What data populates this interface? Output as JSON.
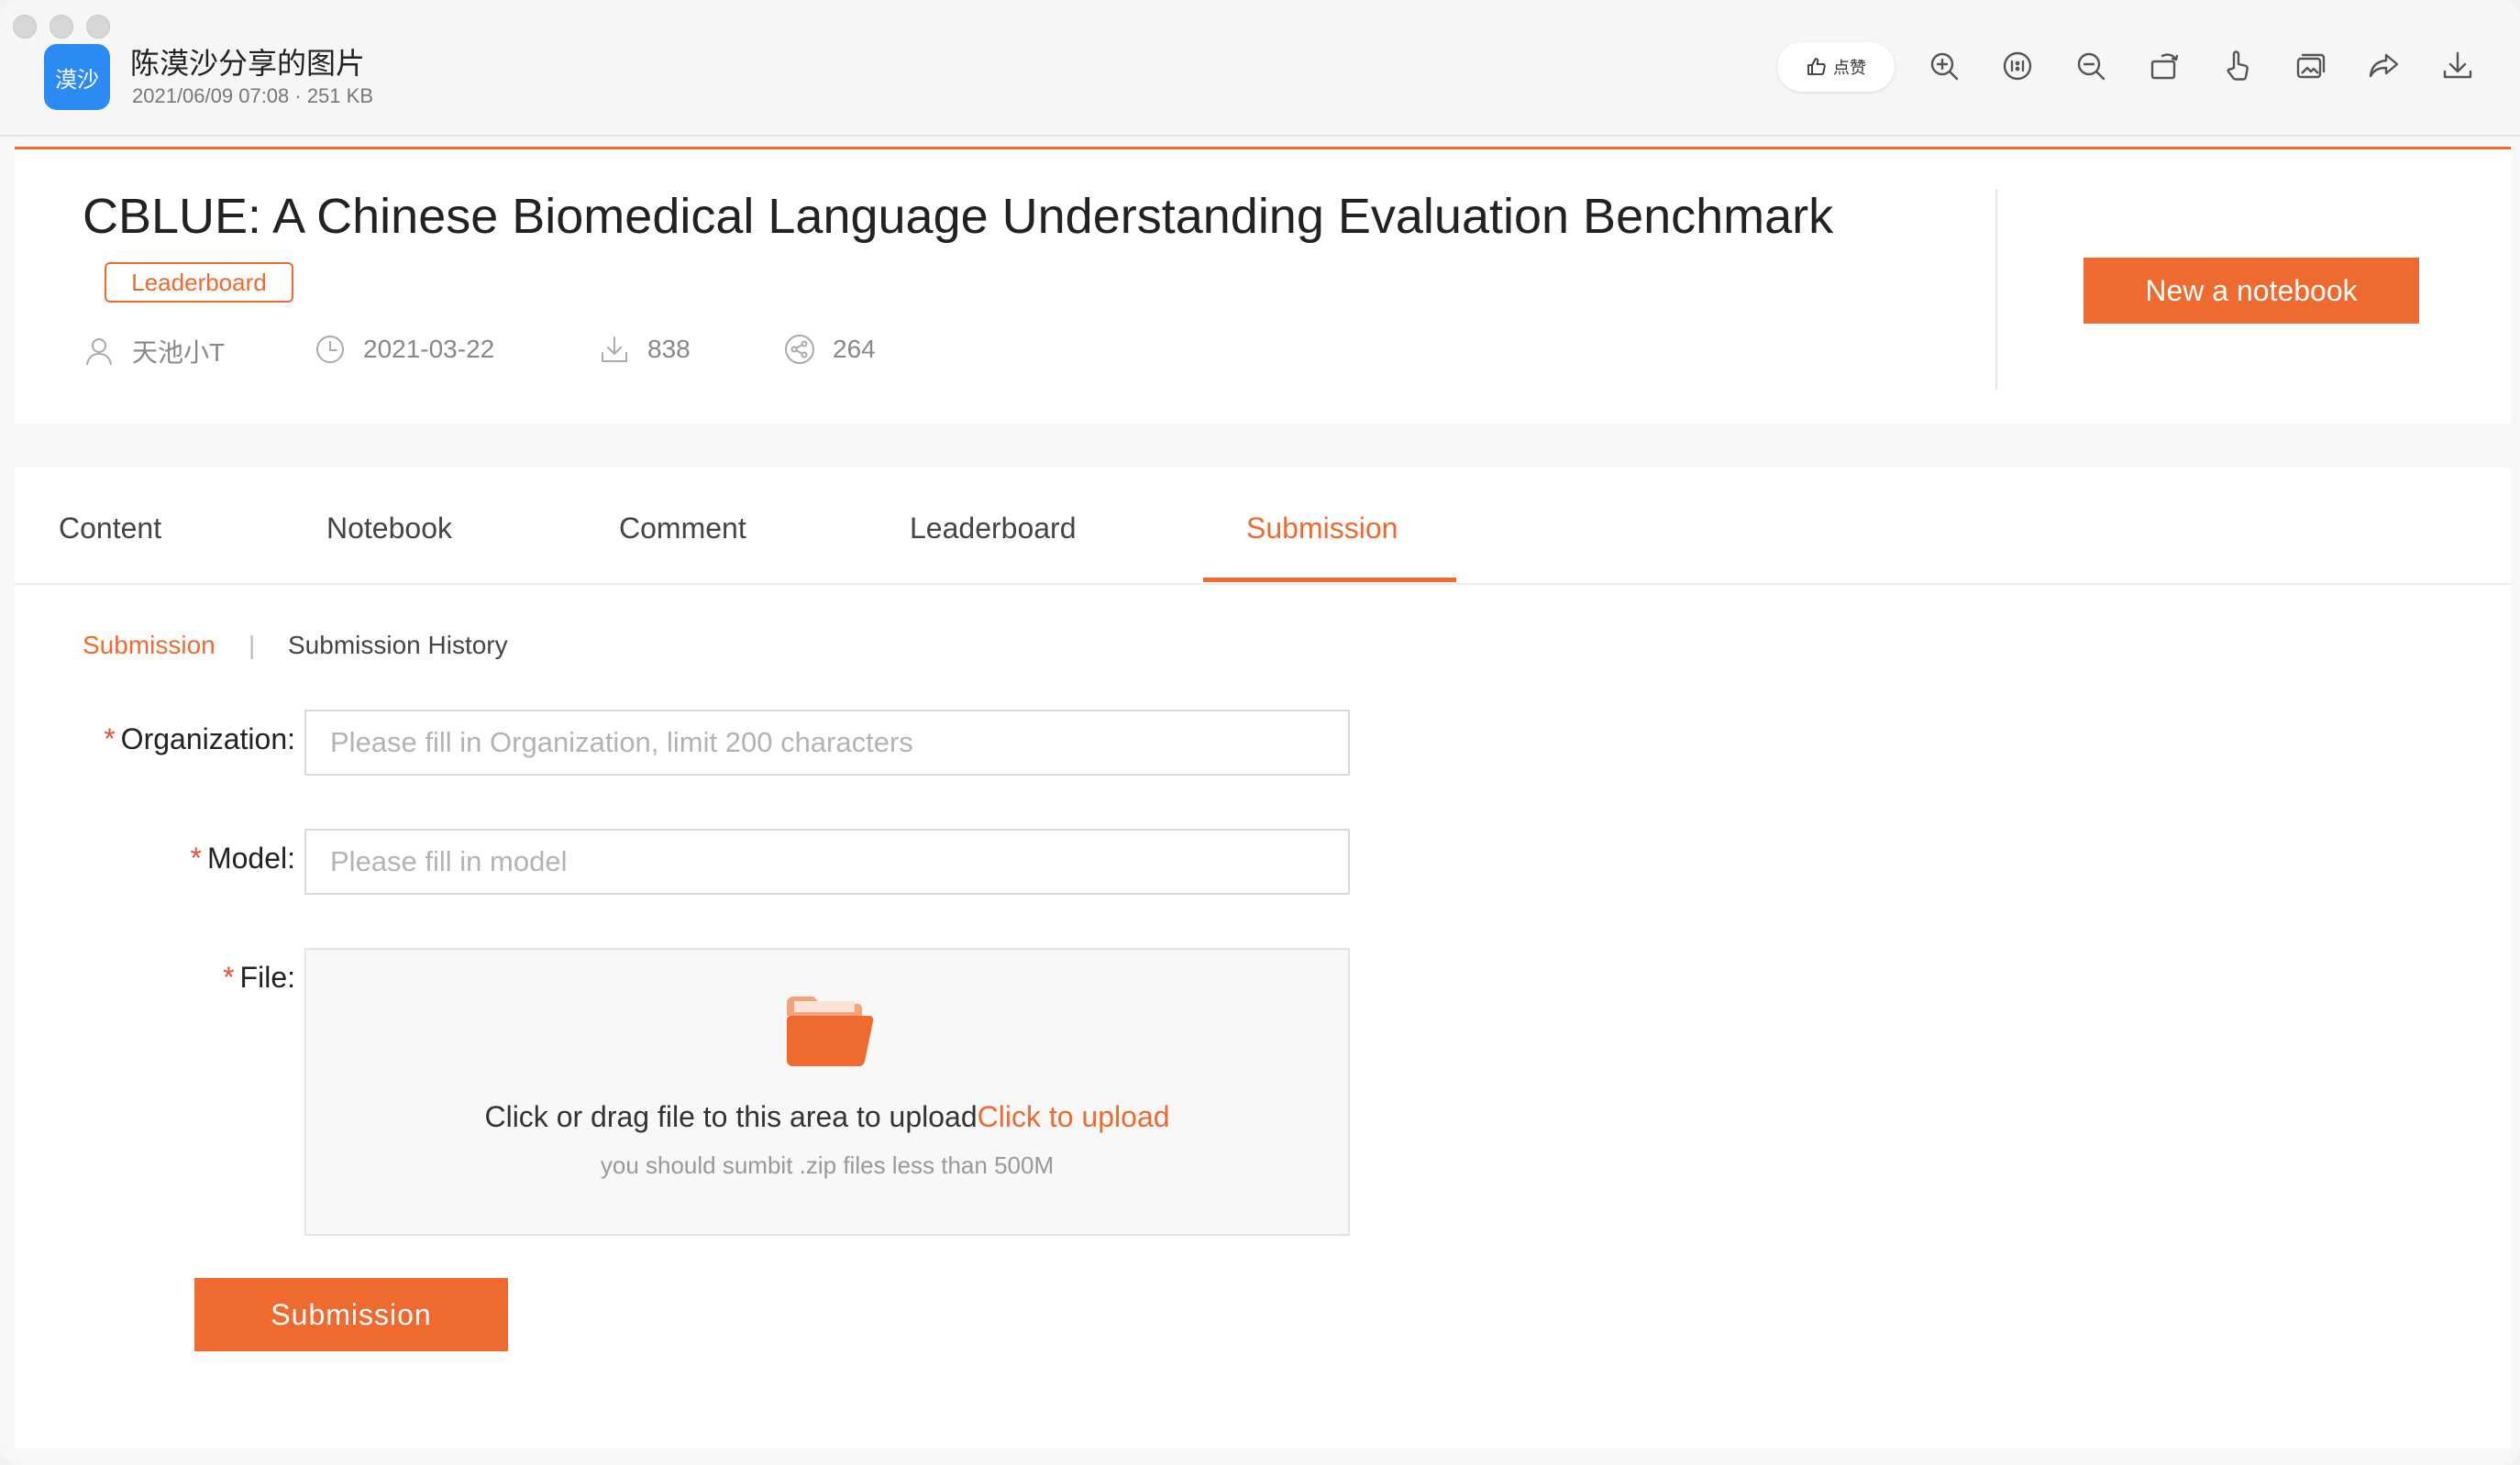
{
  "window": {
    "app_icon_text": "漠沙",
    "title": "陈漠沙分享的图片",
    "meta": "2021/06/09 07:08 · 251 KB",
    "like_label": "点赞"
  },
  "toolbar": {
    "icons": [
      "zoom-in-icon",
      "actual-size-icon",
      "zoom-out-icon",
      "rotate-icon",
      "hand-icon",
      "gallery-icon",
      "share-icon",
      "download-icon"
    ]
  },
  "header": {
    "title": "CBLUE: A Chinese Biomedical Language Understanding Evaluation Benchmark",
    "tag": "Leaderboard",
    "author": "天池小T",
    "date": "2021-03-22",
    "downloads": "838",
    "shares": "264",
    "new_notebook_label": "New a notebook"
  },
  "tabs": [
    {
      "label": "Content"
    },
    {
      "label": "Notebook"
    },
    {
      "label": "Comment"
    },
    {
      "label": "Leaderboard"
    },
    {
      "label": "Submission"
    }
  ],
  "active_tab": "Submission",
  "subnav": {
    "active": "Submission",
    "separator": "|",
    "history": "Submission History"
  },
  "form": {
    "required_mark": "*",
    "organization": {
      "label": "Organization",
      "colon": ":",
      "value": "",
      "placeholder": "Please fill in Organization, limit 200 characters"
    },
    "model": {
      "label": "Model",
      "colon": ":",
      "value": "",
      "placeholder": "Please fill in model"
    },
    "file": {
      "label": "File",
      "colon": ":",
      "drop_text": "Click or drag file to this area to upload",
      "upload_link": "Click to upload",
      "hint": "you should sumbit .zip files less than 500M"
    },
    "submit_label": "Submission"
  },
  "colors": {
    "accent": "#ef6a2f",
    "required": "#ef4a3a",
    "app_icon": "#2a8bf2"
  }
}
